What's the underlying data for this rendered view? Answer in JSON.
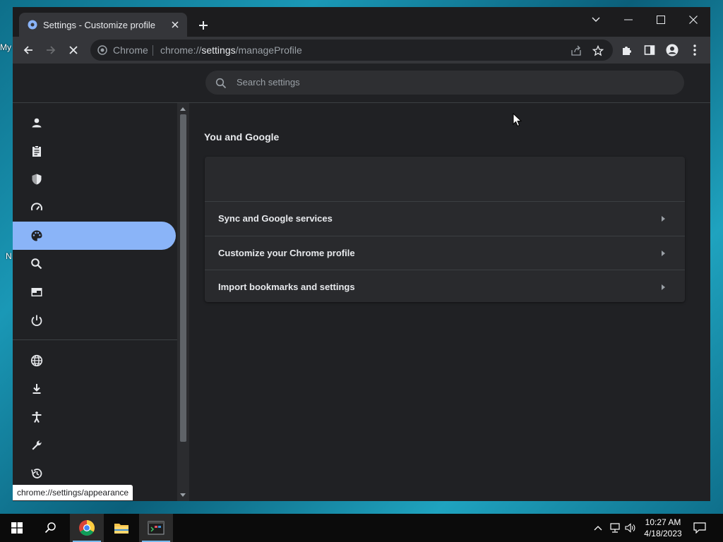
{
  "desktop": {
    "peek_texts": [
      "My",
      "N"
    ]
  },
  "window": {
    "tab_title": "Settings - Customize profile",
    "controls": [
      "tab-search",
      "minimize",
      "maximize",
      "close"
    ]
  },
  "toolbar": {
    "omnibox_origin": "Chrome",
    "url_prefix": "chrome://",
    "url_host": "settings",
    "url_path": "/manageProfile"
  },
  "search": {
    "placeholder": "Search settings"
  },
  "sidebar": {
    "items": [
      {
        "icon": "person-icon",
        "active": false
      },
      {
        "icon": "clipboard-icon",
        "active": false
      },
      {
        "icon": "shield-icon",
        "active": false
      },
      {
        "icon": "speedometer-icon",
        "active": false
      },
      {
        "icon": "palette-icon",
        "active": true
      },
      {
        "icon": "search-icon",
        "active": false
      },
      {
        "icon": "browser-icon",
        "active": false
      },
      {
        "icon": "power-icon",
        "active": false
      },
      {
        "icon": "globe-icon",
        "active": false
      },
      {
        "icon": "download-icon",
        "active": false
      },
      {
        "icon": "accessibility-icon",
        "active": false
      },
      {
        "icon": "wrench-icon",
        "active": false
      },
      {
        "icon": "history-icon",
        "active": false
      }
    ]
  },
  "main": {
    "section_title": "You and Google",
    "rows": [
      {
        "label": "Sync and Google services"
      },
      {
        "label": "Customize your Chrome profile"
      },
      {
        "label": "Import bookmarks and settings"
      }
    ]
  },
  "status_bubble": "chrome://settings/appearance",
  "taskbar": {
    "time": "10:27 AM",
    "date": "4/18/2023"
  },
  "colors": {
    "accent": "#8ab4f8",
    "background": "#202124",
    "card": "#292a2d"
  }
}
